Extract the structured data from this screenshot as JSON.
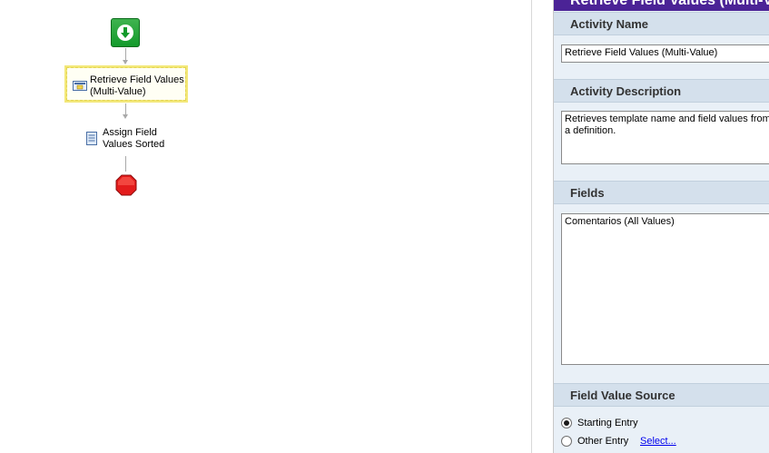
{
  "workflow": {
    "start_node": {
      "icon": "arrow-down-icon",
      "color": "#139a2b"
    },
    "retrieve_node": {
      "label": "Retrieve Field Values (Multi-Value)",
      "icon": "retrieve-field-values-icon",
      "highlight_color": "#f3e87a"
    },
    "assign_node": {
      "label": "Assign Field Values Sorted",
      "icon": "document-icon"
    },
    "end_node": {
      "icon": "stop-sign-icon",
      "color": "#e31c1c"
    }
  },
  "properties": {
    "title": "Retrieve Field Values (Multi-Value)",
    "title_color": "#4b2396",
    "activity_name": {
      "header": "Activity Name",
      "value": "Retrieve Field Values (Multi-Value)"
    },
    "activity_description": {
      "header": "Activity Description",
      "value": "Retrieves template name and field values from a definition."
    },
    "fields": {
      "header": "Fields",
      "value": "Comentarios (All Values)"
    },
    "field_value_source": {
      "header": "Field Value Source",
      "options": [
        {
          "label": "Starting Entry",
          "selected": true
        },
        {
          "label": "Other Entry",
          "selected": false
        }
      ],
      "select_link": "Select..."
    }
  }
}
